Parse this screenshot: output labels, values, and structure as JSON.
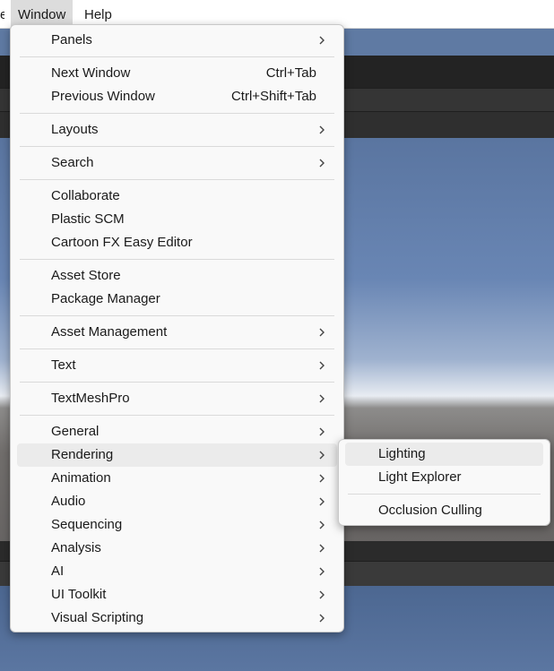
{
  "menubar": {
    "edge_label": "e",
    "items": [
      {
        "label": "Window"
      },
      {
        "label": "Help"
      }
    ]
  },
  "window_menu": {
    "items": [
      {
        "label": "Panels",
        "submenu": true
      },
      {
        "label": "Next Window",
        "shortcut": "Ctrl+Tab"
      },
      {
        "label": "Previous Window",
        "shortcut": "Ctrl+Shift+Tab"
      },
      {
        "label": "Layouts",
        "submenu": true
      },
      {
        "label": "Search",
        "submenu": true
      },
      {
        "label": "Collaborate"
      },
      {
        "label": "Plastic SCM"
      },
      {
        "label": "Cartoon FX Easy Editor"
      },
      {
        "label": "Asset Store"
      },
      {
        "label": "Package Manager"
      },
      {
        "label": "Asset Management",
        "submenu": true
      },
      {
        "label": "Text",
        "submenu": true
      },
      {
        "label": "TextMeshPro",
        "submenu": true
      },
      {
        "label": "General",
        "submenu": true
      },
      {
        "label": "Rendering",
        "submenu": true,
        "highlighted": true
      },
      {
        "label": "Animation",
        "submenu": true
      },
      {
        "label": "Audio",
        "submenu": true
      },
      {
        "label": "Sequencing",
        "submenu": true
      },
      {
        "label": "Analysis",
        "submenu": true
      },
      {
        "label": "AI",
        "submenu": true
      },
      {
        "label": "UI Toolkit",
        "submenu": true
      },
      {
        "label": "Visual Scripting",
        "submenu": true
      }
    ]
  },
  "rendering_submenu": {
    "items": [
      {
        "label": "Lighting",
        "highlighted": true
      },
      {
        "label": "Light Explorer"
      },
      {
        "label": "Occlusion Culling"
      }
    ]
  },
  "icons": {
    "submenu_arrow": "chevron-right-icon"
  },
  "colors": {
    "menu_background": "#f9f9f9",
    "highlight": "#ebebeb",
    "separator": "#dadada",
    "text": "#1a1a1a"
  }
}
